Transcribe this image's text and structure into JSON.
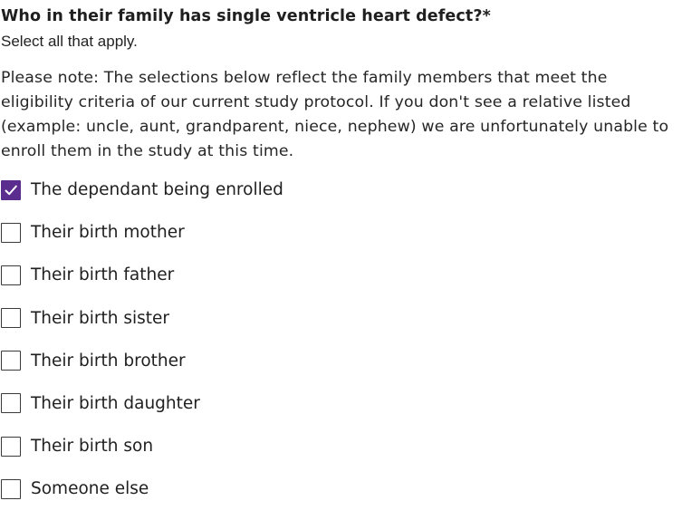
{
  "question": {
    "text": "Who in their family has single ventricle heart defect?*",
    "hint": "Select all that apply."
  },
  "note": "Please note: The selections below reflect the family members that meet the eligibility criteria of our current study protocol. If you don't see a relative listed (example: uncle, aunt, grandparent, niece, nephew) we are unfortunately unable to enroll them in the study at this time.",
  "colors": {
    "checked_fill": "#5b2d8e",
    "check_mark": "#ffffff"
  },
  "options": [
    {
      "label": "The dependant being enrolled",
      "checked": true
    },
    {
      "label": "Their birth mother",
      "checked": false
    },
    {
      "label": "Their birth father",
      "checked": false
    },
    {
      "label": "Their birth sister",
      "checked": false
    },
    {
      "label": "Their birth brother",
      "checked": false
    },
    {
      "label": "Their birth daughter",
      "checked": false
    },
    {
      "label": "Their birth son",
      "checked": false
    },
    {
      "label": "Someone else",
      "checked": false
    }
  ]
}
